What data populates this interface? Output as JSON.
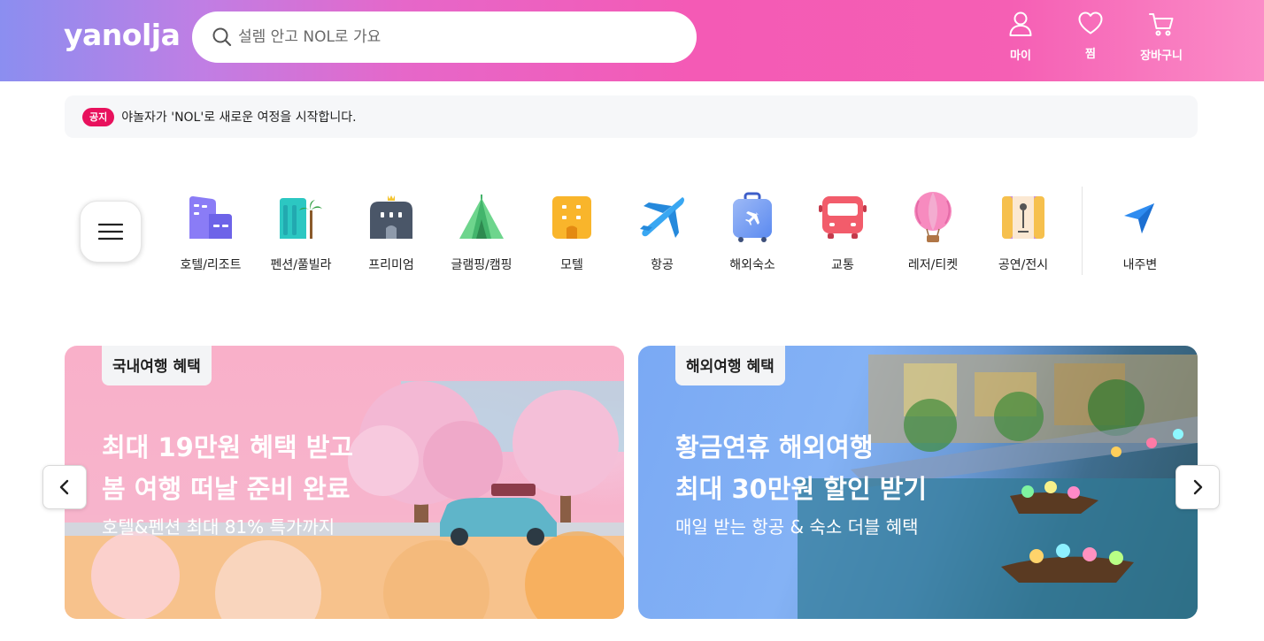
{
  "header": {
    "logo": "yanolja",
    "search_placeholder": "설렘 안고 NOL로 가요",
    "buttons": [
      {
        "label": "마이",
        "icon": "user-icon"
      },
      {
        "label": "찜",
        "icon": "heart-icon"
      },
      {
        "label": "장바구니",
        "icon": "cart-icon"
      }
    ]
  },
  "notice": {
    "badge": "공지",
    "text": "야놀자가 'NOL'로 새로운 여정을 시작합니다."
  },
  "categories": [
    {
      "label": "호텔/리조트",
      "icon": "hotel-icon"
    },
    {
      "label": "펜션/풀빌라",
      "icon": "pension-icon"
    },
    {
      "label": "프리미엄",
      "icon": "premium-icon"
    },
    {
      "label": "글램핑/캠핑",
      "icon": "tent-icon"
    },
    {
      "label": "모텔",
      "icon": "motel-icon"
    },
    {
      "label": "항공",
      "icon": "airplane-icon"
    },
    {
      "label": "해외숙소",
      "icon": "suitcase-icon"
    },
    {
      "label": "교통",
      "icon": "bus-icon"
    },
    {
      "label": "레저/티켓",
      "icon": "balloon-icon"
    },
    {
      "label": "공연/전시",
      "icon": "microphone-icon"
    }
  ],
  "nearby": {
    "label": "내주변",
    "icon": "location-arrow-icon"
  },
  "banners": [
    {
      "tag": "국내여행 혜택",
      "line1": "최대 19만원 혜택 받고",
      "line2": "봄 여행 떠날 준비 완료",
      "sub": "호텔&펜션 최대 81% 특가까지"
    },
    {
      "tag": "해외여행 혜택",
      "line1": "황금연휴 해외여행",
      "line2": "최대 30만원 할인 받기",
      "sub": "매일 받는 항공 & 숙소 더블 혜택"
    }
  ],
  "colors": {
    "brand_pink": "#f45ab5",
    "notice_badge": "#e8115d",
    "nearby_blue": "#2f8cf0"
  }
}
